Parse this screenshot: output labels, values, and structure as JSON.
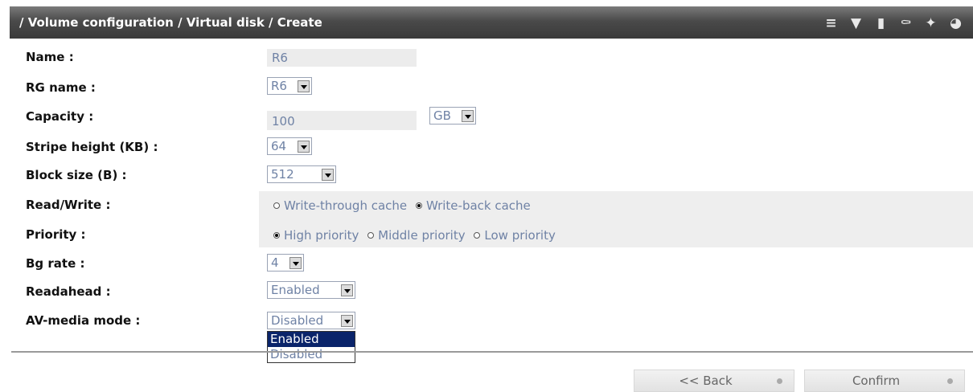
{
  "header": {
    "title": "/ Volume configuration / Virtual disk / Create",
    "icons": [
      "stack-icon",
      "thermometer-icon",
      "battery-icon",
      "power-plug-icon",
      "fan-icon",
      "speed-icon"
    ]
  },
  "form": {
    "name_label": "Name :",
    "name_value": "R6",
    "rg_label": "RG name :",
    "rg_value": "R6",
    "capacity_label": "Capacity :",
    "capacity_value": "100",
    "capacity_unit": "GB",
    "stripe_label": "Stripe height (KB) :",
    "stripe_value": "64",
    "block_label": "Block size (B) :",
    "block_value": "512",
    "rw_label": "Read/Write :",
    "rw_options": [
      "Write-through cache",
      "Write-back cache"
    ],
    "rw_selected": "Write-back cache",
    "priority_label": "Priority :",
    "priority_options": [
      "High priority",
      "Middle priority",
      "Low priority"
    ],
    "priority_selected": "High priority",
    "bg_label": "Bg rate :",
    "bg_value": "4",
    "readahead_label": "Readahead :",
    "readahead_value": "Enabled",
    "av_label": "AV-media mode :",
    "av_value": "Disabled",
    "av_options": [
      "Enabled",
      "Disabled"
    ],
    "av_highlighted": "Enabled"
  },
  "buttons": {
    "back": "<< Back",
    "confirm": "Confirm"
  }
}
